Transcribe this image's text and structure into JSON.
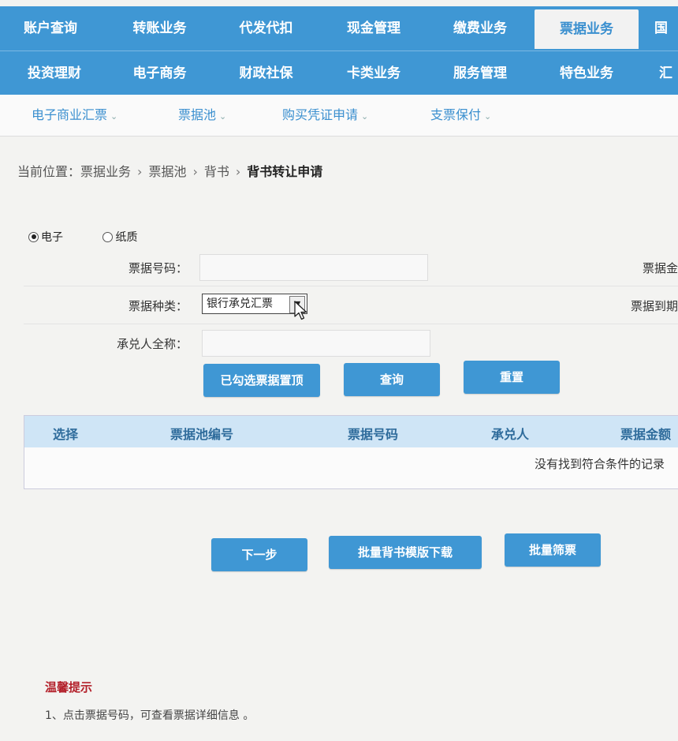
{
  "nav": {
    "row1": [
      "账户查询",
      "转账业务",
      "代发代扣",
      "现金管理",
      "缴费业务",
      "票据业务",
      "国"
    ],
    "row2": [
      "投资理财",
      "电子商务",
      "财政社保",
      "卡类业务",
      "服务管理",
      "特色业务",
      "汇"
    ],
    "active": "票据业务"
  },
  "subnav": [
    "电子商业汇票",
    "票据池",
    "购买凭证申请",
    "支票保付"
  ],
  "breadcrumb": {
    "prefix": "当前位置：",
    "items": [
      "票据业务",
      "票据池",
      "背书"
    ],
    "current": "背书转让申请"
  },
  "form": {
    "radio_electronic": "电子",
    "radio_paper": "纸质",
    "selected_type": "电子",
    "bill_no_label": "票据号码：",
    "bill_no_value": "",
    "bill_kind_label": "票据种类：",
    "bill_kind_value": "银行承兑汇票",
    "acceptor_label": "承兑人全称：",
    "acceptor_value": "",
    "right_label_1": "票据金",
    "right_label_2": "票据到期"
  },
  "buttons": {
    "selected": "已勾选票据置顶",
    "query": "查询",
    "reset": "重置",
    "next": "下一步",
    "batch_template": "批量背书模版下载",
    "batch_select": "批量筛票"
  },
  "table": {
    "columns": [
      "选择",
      "票据池编号",
      "票据号码",
      "承兑人",
      "票据金额"
    ],
    "empty_text": "没有找到符合条件的记录"
  },
  "tips": {
    "title": "温馨提示",
    "line1": "1、点击票据号码，可查看票据详细信息 。"
  },
  "colors": {
    "nav_bg": "#3f97d4",
    "header_bg": "#cfe5f6",
    "tip_title": "#b3202a"
  },
  "icons": [
    "chevron-down-icon",
    "mouse-cursor-icon"
  ]
}
